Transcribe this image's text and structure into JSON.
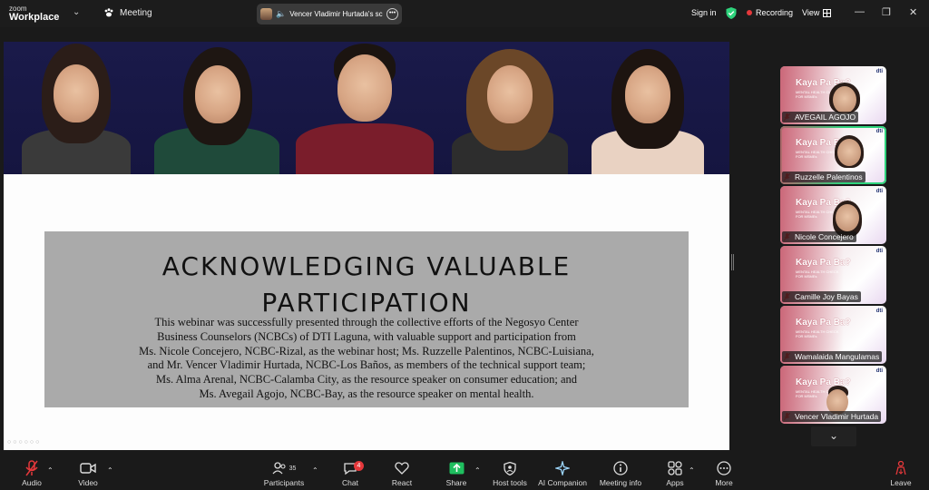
{
  "app": {
    "brand_line1": "zoom",
    "brand_line2": "Workplace"
  },
  "topbar": {
    "meeting_label": "Meeting",
    "share_title": "Vencer Vladimir Hurtada's sc",
    "signin_label": "Sign in",
    "recording_label": "Recording",
    "view_label": "View"
  },
  "slide": {
    "title_line1": "ACKNOWLEDGING VALUABLE",
    "title_line2": "PARTICIPATION",
    "body_lines": [
      "This webinar was successfully presented through the collective efforts of the Negosyo Center",
      "Business Counselors (NCBCs) of DTI Laguna, with valuable support and participation from",
      "Ms. Nicole Concejero, NCBC-Rizal, as the webinar host; Ms. Ruzzelle Palentinos, NCBC-Luisiana,",
      "and Mr. Vencer Vladimir Hurtada, NCBC-Los Baños, as members of the technical support team;",
      "Ms. Alma Arenal, NCBC-Calamba City, as the resource speaker on consumer education; and",
      "Ms. Avegail Agojo, NCBC-Bay, as the resource speaker on mental health."
    ]
  },
  "tile_bg": {
    "title": "Kaya Pa Ba?",
    "sub1": "MENTAL HEALTH CHECK",
    "sub2": "FOR MSMEs",
    "logo": "dti"
  },
  "participants": [
    {
      "name": "AVEGAIL AGOJO",
      "active": false
    },
    {
      "name": "Ruzzelle Palentinos",
      "active": true
    },
    {
      "name": "Nicole Concejero",
      "active": false
    },
    {
      "name": "Camille Joy Bayas",
      "active": false
    },
    {
      "name": "Wamalaida Mangulamas",
      "active": false
    },
    {
      "name": "Vencer Vladimir Hurtada",
      "active": false
    }
  ],
  "toolbar": {
    "audio": "Audio",
    "video": "Video",
    "participants": "Participants",
    "participants_count": "35",
    "chat": "Chat",
    "chat_badge": "4",
    "react": "React",
    "share": "Share",
    "host_tools": "Host tools",
    "ai_companion": "AI Companion",
    "meeting_info": "Meeting info",
    "apps": "Apps",
    "more": "More",
    "leave": "Leave"
  },
  "colors": {
    "accent_green": "#2ed37c",
    "recording_red": "#e5383b",
    "share_green": "#1fbf5f",
    "leave_red": "#e5383b"
  }
}
